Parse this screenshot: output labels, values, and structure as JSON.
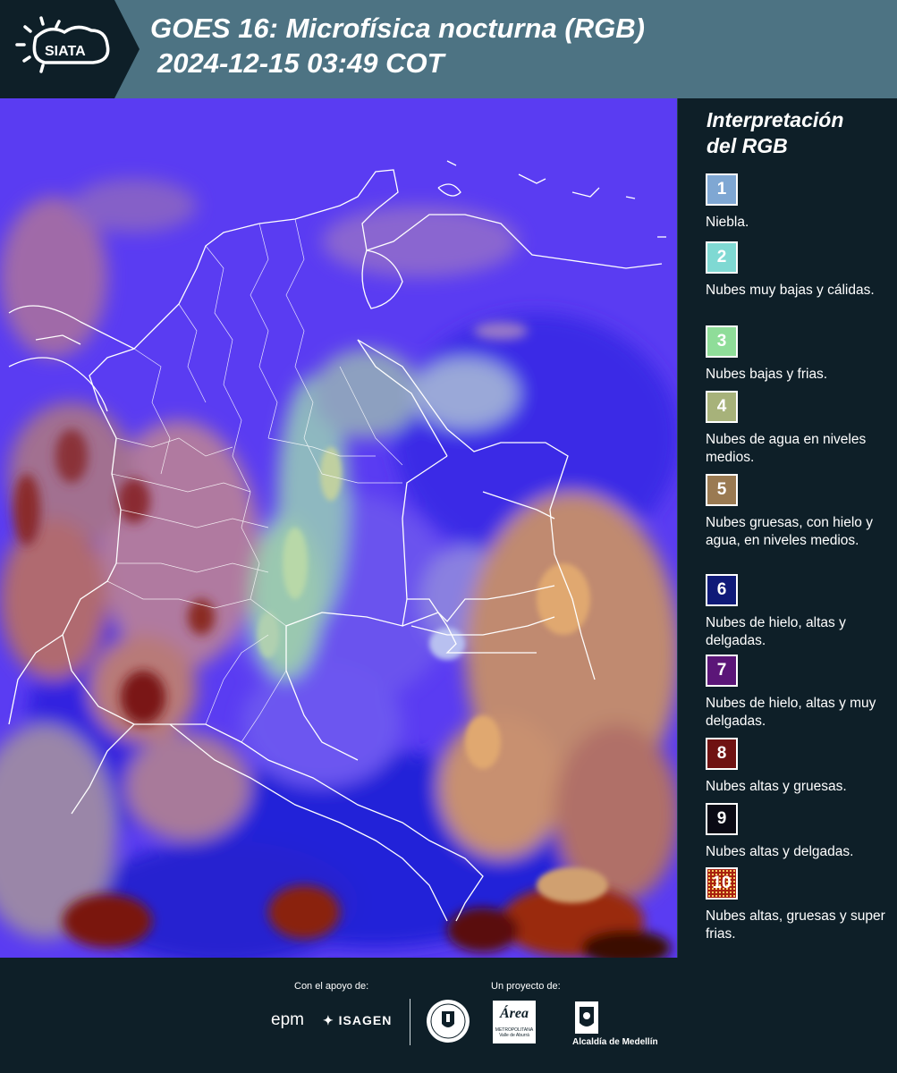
{
  "header": {
    "logo_text": "SIATA",
    "title": "GOES 16: Microfísica nocturna (RGB)",
    "timestamp": "2024-12-15 03:49 COT"
  },
  "legend": {
    "title_line1": "Interpretación",
    "title_line2": "del RGB",
    "items": [
      {
        "num": "1",
        "color": "#7fa7d3",
        "label": "Niebla."
      },
      {
        "num": "2",
        "color": "#7fd9d3",
        "label": "Nubes muy bajas y cálidas."
      },
      {
        "num": "3",
        "color": "#8fdd99",
        "label": "Nubes bajas y frias."
      },
      {
        "num": "4",
        "color": "#a7b27a",
        "label": "Nubes de agua en niveles medios."
      },
      {
        "num": "5",
        "color": "#9a7a52",
        "label": "Nubes gruesas, con hielo y agua, en niveles medios."
      },
      {
        "num": "6",
        "color": "#0f1a78",
        "label": "Nubes de hielo, altas y delgadas."
      },
      {
        "num": "7",
        "color": "#5b1678",
        "label": "Nubes de hielo, altas y muy delgadas."
      },
      {
        "num": "8",
        "color": "#6f1212",
        "label": "Nubes altas y gruesas."
      },
      {
        "num": "9",
        "color": "#0a0a14",
        "label": "Nubes altas y delgadas."
      },
      {
        "num": "10",
        "color": "#a8200f",
        "label": "Nubes altas, gruesas y super frias."
      }
    ]
  },
  "footer": {
    "support_label": "Con el apoyo de:",
    "project_label": "Un proyecto de:",
    "sponsor1": "epm",
    "sponsor2": "ISAGEN",
    "partner_area": "Área",
    "partner_area_sub": "METROPOLITANA",
    "partner_area_sub2": "Valle de Aburrá",
    "partner_alcaldia": "Alcaldía de Medellín"
  }
}
